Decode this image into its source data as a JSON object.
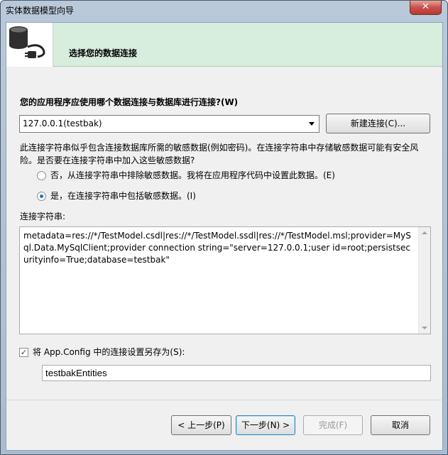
{
  "window": {
    "title": "实体数据模型向导",
    "close_label": "✕"
  },
  "header": {
    "title": "选择您的数据连接",
    "icon": "database-plug-icon"
  },
  "question": "您的应用程序应使用哪个数据连接与数据库进行连接?(W)",
  "connection": {
    "selected": "127.0.0.1(testbak)",
    "new_button": "新建连接(C)..."
  },
  "sensitive": {
    "warning": "此连接字符串似乎包含连接数据库所需的敏感数据(例如密码)。在连接字符串中存储敏感数据可能有安全风险。是否要在连接字符串中加入这些敏感数据?",
    "option_exclude": "否，从连接字符串中排除敏感数据。我将在应用程序代码中设置此数据。(E)",
    "option_include": "是，在连接字符串中包括敏感数据。(I)",
    "selected": "include"
  },
  "connection_string": {
    "label": "连接字符串:",
    "value": "metadata=res://*/TestModel.csdl|res://*/TestModel.ssdl|res://*/TestModel.msl;provider=MySql.Data.MySqlClient;provider connection string=\"server=127.0.0.1;user id=root;persistsecurityinfo=True;database=testbak\""
  },
  "save": {
    "checkbox_label": "将 App.Config 中的连接设置另存为(S):",
    "checked": true,
    "entity_name": "testbakEntities"
  },
  "footer": {
    "back": "< 上一步(P)",
    "next": "下一步(N) >",
    "finish": "完成(F)",
    "cancel": "取消"
  }
}
